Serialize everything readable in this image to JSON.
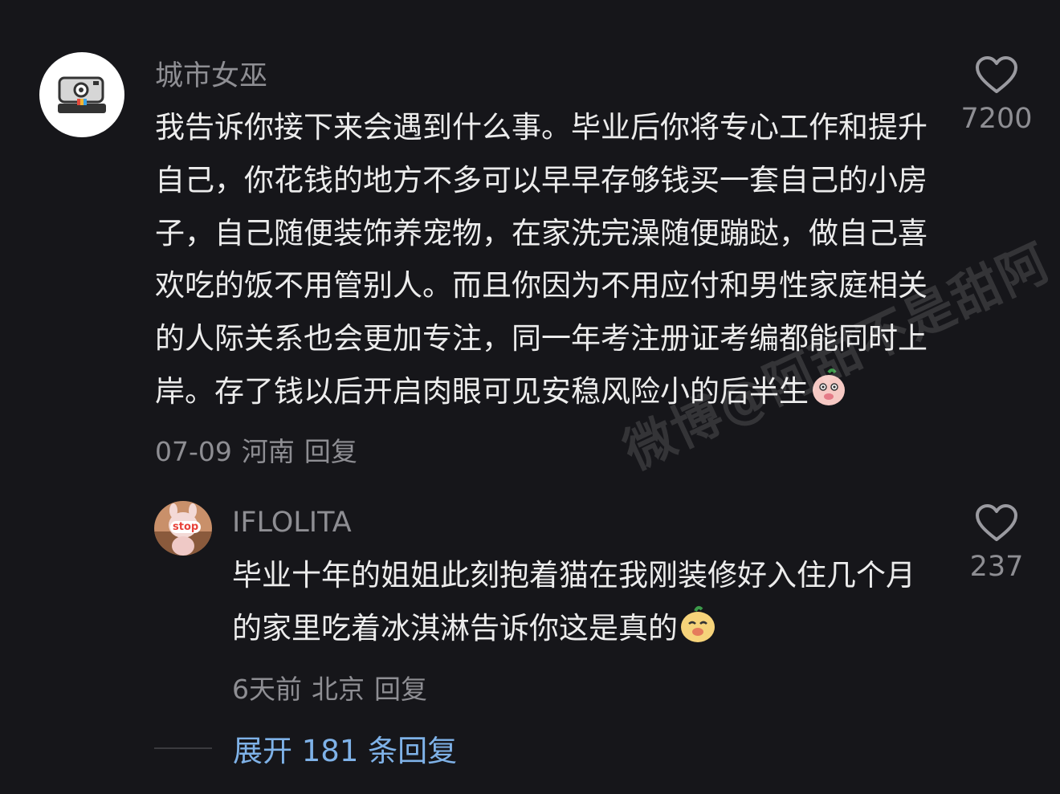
{
  "comment": {
    "username": "城市女巫",
    "text": "我告诉你接下来会遇到什么事。毕业后你将专心工作和提升自己，你花钱的地方不多可以早早存够钱买一套自己的小房子，自己随便装饰养宠物，在家洗完澡随便蹦跶，做自己喜欢吃的饭不用管别人。而且你因为不用应付和男性家庭相关的人际关系也会更加专注，同一年考注册证考编都能同时上岸。存了钱以后开启肉眼可见安稳风险小的后半生",
    "date": "07-09",
    "location": "河南",
    "reply_label": "回复",
    "like_count": "7200"
  },
  "reply": {
    "username": "IFLOLITA",
    "text": "毕业十年的姐姐此刻抱着猫在我刚装修好入住几个月的家里吃着冰淇淋告诉你这是真的",
    "avatar_badge": "stop",
    "date": "6天前",
    "location": "北京",
    "reply_label": "回复",
    "like_count": "237"
  },
  "expand": {
    "label": "展开 181 条回复"
  },
  "watermark": "微博@阿甜不是甜阿",
  "colors": {
    "background": "#16161a",
    "text": "#ececec",
    "secondary": "#8e8e93",
    "link": "#7fb2e8"
  }
}
